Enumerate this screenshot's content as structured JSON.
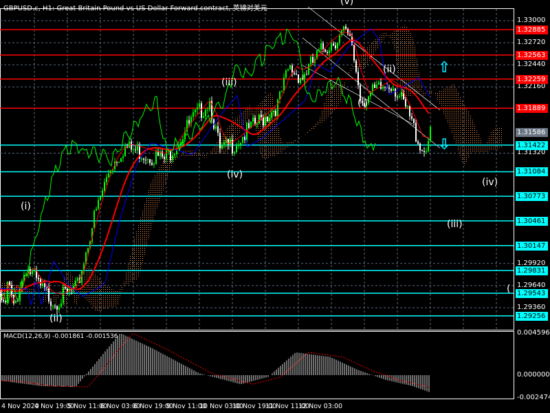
{
  "title": "GBPUSD.c, H1:  Great Britain Pound vs US Dollar Forward contract, 英镑对美元",
  "macd_label": "MACD(12,26,9) -0.001861 -0.001536",
  "colors": {
    "bull": "#00ff00",
    "bear": "#ffffff",
    "ma": "#ff0000",
    "kijun": "#0000ff",
    "chikou": "#00ff00",
    "cloud": "#ff9a55",
    "support": "#00ffff",
    "resistance": "#ff0000"
  },
  "chart_data": {
    "type": "line",
    "symbol": "GBPUSD.c",
    "timeframe": "H1",
    "ylim": [
      1.291,
      1.334
    ],
    "y_ticks": [
      "1.33000",
      "1.32720",
      "1.32440",
      "1.32160",
      "1.31320",
      "1.29920",
      "1.29640",
      "1.29360"
    ],
    "x_ticks": [
      "4 Nov 2020",
      "4 Nov 19:00",
      "5 Nov 11:00",
      "6 Nov 03:00",
      "6 Nov 19:00",
      "9 Nov 11:00",
      "10 Nov 03:00",
      "10 Nov 19:00",
      "11 Nov 11:00",
      "12 Nov 03:00"
    ],
    "current_price": "1.31586",
    "resistance_levels": [
      "1.32885",
      "1.32563",
      "1.32259",
      "1.31889"
    ],
    "support_levels": [
      "1.31422",
      "1.31084",
      "1.30773",
      "1.30461",
      "1.30147",
      "1.29831",
      "1.29543",
      "1.29256"
    ],
    "price_path": [
      [
        0,
        1.296
      ],
      [
        6,
        1.2935
      ],
      [
        12,
        1.2975
      ],
      [
        20,
        1.294
      ],
      [
        38,
        1.2995
      ],
      [
        60,
        1.2965
      ],
      [
        80,
        1.295
      ],
      [
        100,
        1.296
      ],
      [
        112,
        1.2965
      ],
      [
        135,
        1.305
      ],
      [
        160,
        1.312
      ],
      [
        180,
        1.3145
      ],
      [
        200,
        1.314
      ],
      [
        240,
        1.313
      ],
      [
        280,
        1.318
      ],
      [
        305,
        1.3205
      ],
      [
        320,
        1.314
      ],
      [
        340,
        1.315
      ],
      [
        380,
        1.318
      ],
      [
        405,
        1.32
      ],
      [
        420,
        1.3245
      ],
      [
        440,
        1.3235
      ],
      [
        470,
        1.327
      ],
      [
        500,
        1.329
      ],
      [
        512,
        1.3275
      ],
      [
        525,
        1.3205
      ],
      [
        545,
        1.3215
      ],
      [
        570,
        1.3228
      ],
      [
        595,
        1.3185
      ],
      [
        615,
        1.314
      ],
      [
        626,
        1.316
      ]
    ],
    "macd": {
      "ylim": [
        -0.002474,
        0.004596
      ],
      "y_ticks": [
        "0.004596",
        "0.000000",
        "-0.002474"
      ],
      "histogram_path": [
        [
          0,
          -0.0006
        ],
        [
          60,
          -0.0012
        ],
        [
          110,
          -0.0013
        ],
        [
          130,
          0.0005
        ],
        [
          175,
          0.0046
        ],
        [
          220,
          0.003
        ],
        [
          290,
          0.0002
        ],
        [
          350,
          -0.001
        ],
        [
          390,
          -0.0002
        ],
        [
          430,
          0.0025
        ],
        [
          480,
          0.002
        ],
        [
          520,
          0.0006
        ],
        [
          560,
          -0.0005
        ],
        [
          600,
          -0.0012
        ],
        [
          626,
          -0.0019
        ]
      ]
    }
  },
  "waves": [
    {
      "label": "(i)"
    },
    {
      "label": "(ii)"
    },
    {
      "label": "(iii)"
    },
    {
      "label": "(iv)"
    },
    {
      "label": "(v)"
    },
    {
      "label": "(i)"
    },
    {
      "label": "(ii)"
    },
    {
      "label": "(iii)"
    },
    {
      "label": "(iv)"
    },
    {
      "label": "("
    }
  ]
}
